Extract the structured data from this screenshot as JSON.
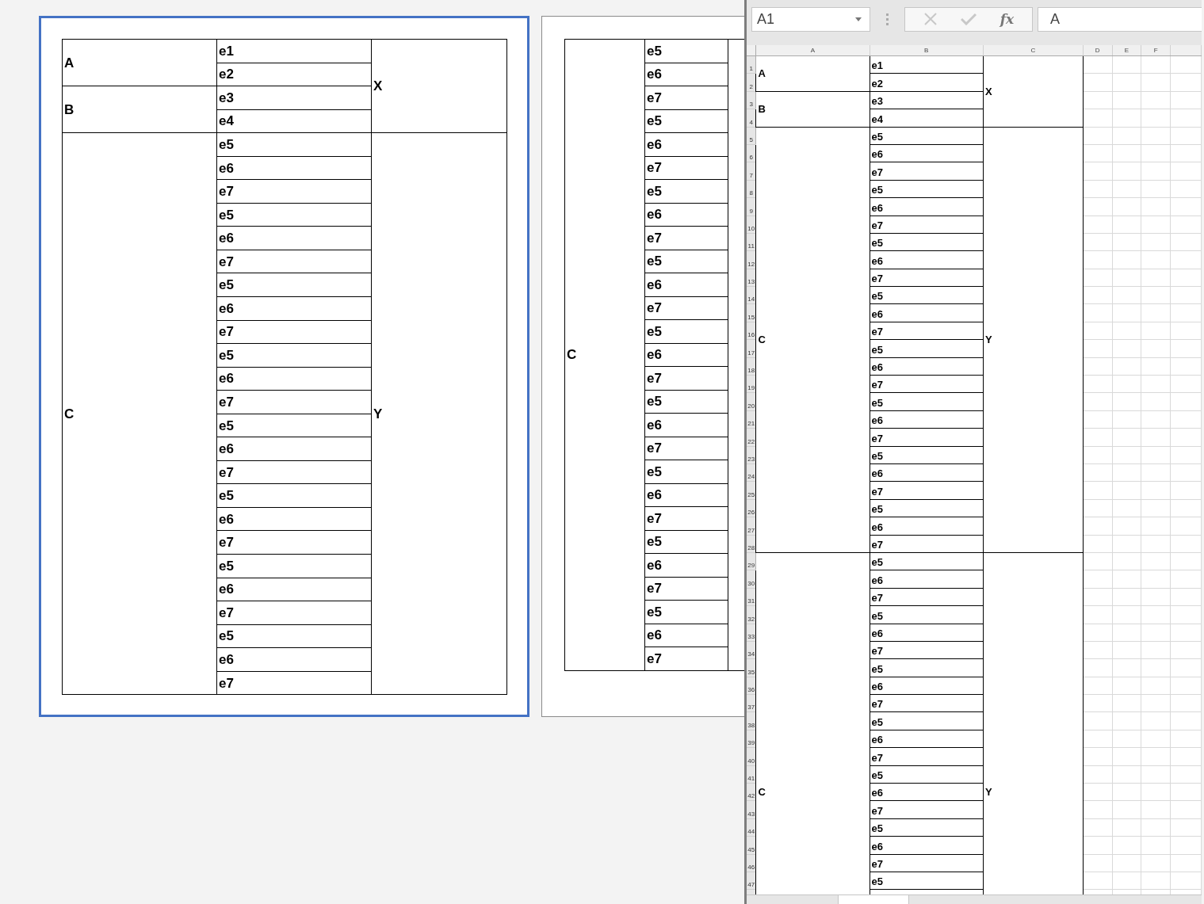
{
  "pages": [
    {
      "selected": true,
      "sections": [
        {
          "label": "X",
          "groups": [
            {
              "label": "A",
              "items": [
                "e1",
                "e2"
              ]
            },
            {
              "label": "B",
              "items": [
                "e3",
                "e4"
              ]
            }
          ]
        },
        {
          "label": "Y",
          "groups": [
            {
              "label": "C",
              "items": [
                "e5",
                "e6",
                "e7",
                "e5",
                "e6",
                "e7",
                "e5",
                "e6",
                "e7",
                "e5",
                "e6",
                "e7",
                "e5",
                "e6",
                "e7",
                "e5",
                "e6",
                "e7",
                "e5",
                "e6",
                "e7",
                "e5",
                "e6",
                "e7"
              ]
            }
          ]
        }
      ]
    },
    {
      "selected": false,
      "sections": [
        {
          "groups": [
            {
              "label": "C",
              "items": [
                "e5",
                "e6",
                "e7",
                "e5",
                "e6",
                "e7",
                "e5",
                "e6",
                "e7",
                "e5",
                "e6",
                "e7",
                "e5",
                "e6",
                "e7",
                "e5",
                "e6",
                "e7",
                "e5",
                "e6",
                "e7",
                "e5",
                "e6",
                "e7",
                "e5",
                "e6",
                "e7"
              ]
            }
          ]
        }
      ]
    }
  ],
  "spreadsheet": {
    "name_box": "A1",
    "function_label": "fx",
    "formula": "A",
    "columns": [
      "A",
      "B",
      "C",
      "D",
      "E",
      "F"
    ],
    "row_numbers": [
      "1",
      "2",
      "3",
      "4",
      "5",
      "6",
      "7",
      "8",
      "9",
      "10",
      "11",
      "12",
      "13",
      "14",
      "15",
      "16",
      "17",
      "18",
      "19",
      "20",
      "21",
      "22",
      "23",
      "24",
      "25",
      "26",
      "27",
      "28",
      "29",
      "30",
      "31",
      "32",
      "33",
      "34",
      "35",
      "36",
      "37",
      "38",
      "39",
      "40",
      "41",
      "42",
      "43",
      "44",
      "45",
      "46",
      "47"
    ],
    "sections": [
      {
        "label": "X",
        "groups": [
          {
            "label": "A",
            "items": [
              "e1",
              "e2"
            ]
          },
          {
            "label": "B",
            "items": [
              "e3",
              "e4"
            ]
          }
        ]
      },
      {
        "label": "Y",
        "groups": [
          {
            "label": "C",
            "items": [
              "e5",
              "e6",
              "e7",
              "e5",
              "e6",
              "e7",
              "e5",
              "e6",
              "e7",
              "e5",
              "e6",
              "e7",
              "e5",
              "e6",
              "e7",
              "e5",
              "e6",
              "e7",
              "e5",
              "e6",
              "e7",
              "e5",
              "e6",
              "e7"
            ]
          }
        ]
      },
      {
        "label": "Y",
        "groups": [
          {
            "label": "C",
            "items": [
              "e5",
              "e6",
              "e7",
              "e5",
              "e6",
              "e7",
              "e5",
              "e6",
              "e7",
              "e5",
              "e6",
              "e7",
              "e5",
              "e6",
              "e7",
              "e5",
              "e6",
              "e7",
              "e5"
            ]
          }
        ]
      }
    ]
  }
}
